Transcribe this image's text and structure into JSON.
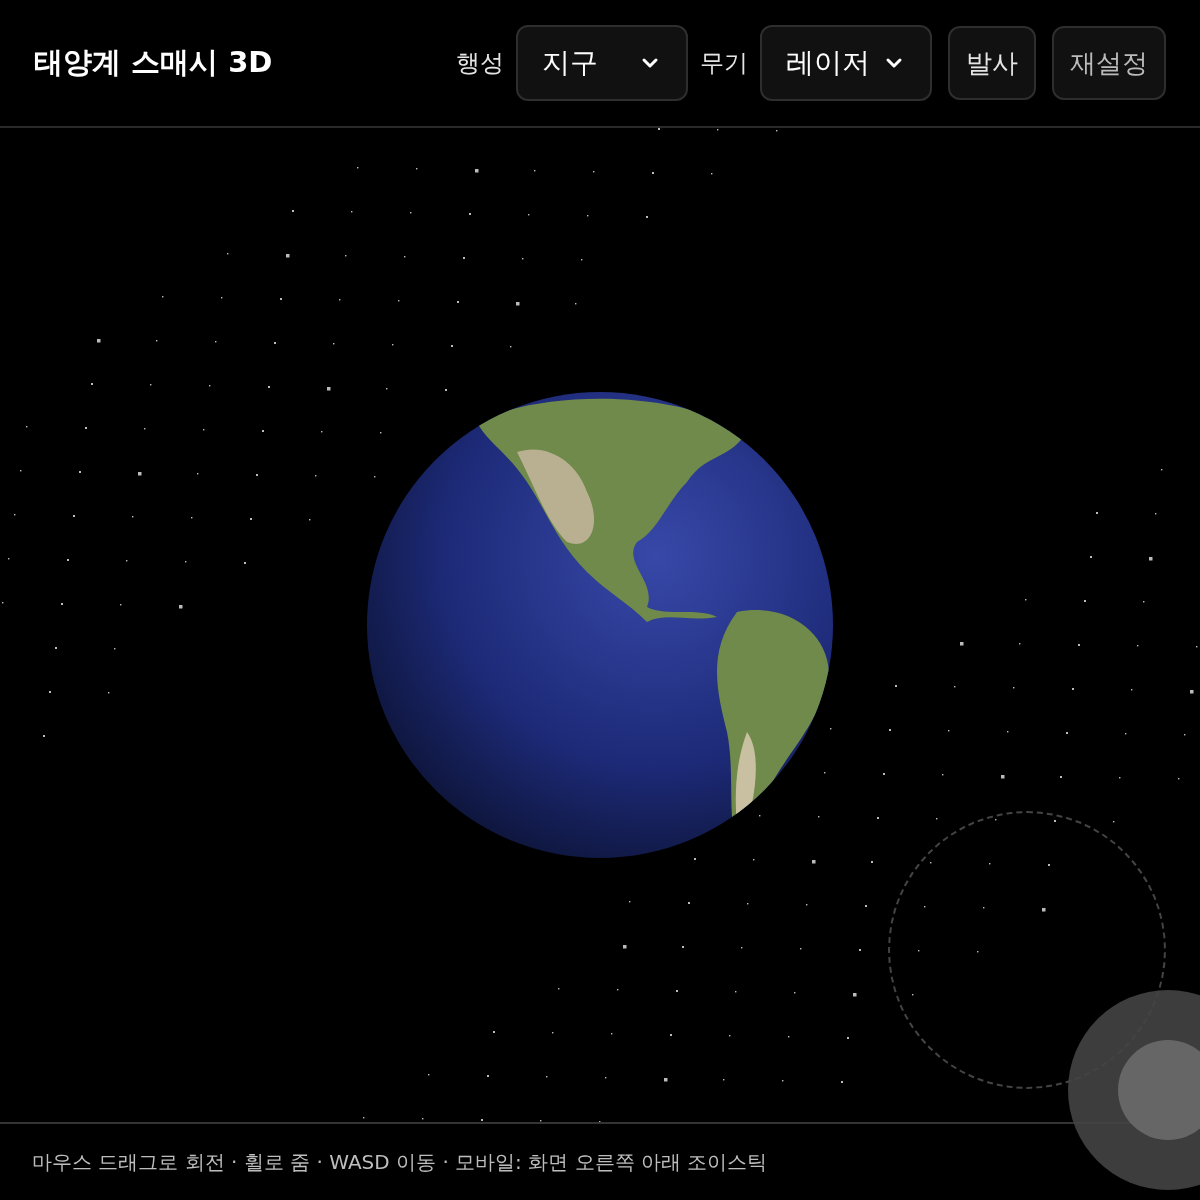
{
  "header": {
    "title": "태양계 스매시 3D",
    "planet": {
      "label": "행성",
      "value": "지구"
    },
    "weapon": {
      "label": "무기",
      "value": "레이저"
    },
    "buttons": [
      "발사",
      "재설정"
    ]
  },
  "footer": {
    "hint": "마우스 드래그로 회전 · 휠로 줌 · WASD 이동 · 모바일: 화면 오른쪽 아래 조이스틱"
  }
}
